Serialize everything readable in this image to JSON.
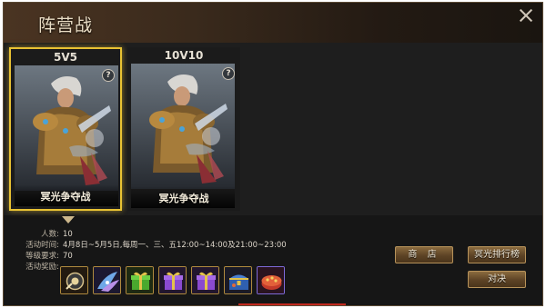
{
  "header": {
    "title": "阵营战"
  },
  "cards": [
    {
      "mode": "5V5",
      "map_name": "冥光争夺战",
      "help": "?",
      "selected": true
    },
    {
      "mode": "10V10",
      "map_name": "冥光争夺战",
      "help": "?",
      "selected": false
    }
  ],
  "info": {
    "players_label": "人数:",
    "players_value": "10",
    "time_label": "活动时间:",
    "time_value": "4月8日~5月5日,每周一、三、五12:00~14:00及21:00~23:00",
    "level_label": "等级要求:",
    "level_value": "70",
    "rewards_label": "活动奖励:"
  },
  "rewards": [
    {
      "icon": "gear-emblem-icon"
    },
    {
      "icon": "blue-wings-icon"
    },
    {
      "icon": "green-gift-box-icon"
    },
    {
      "icon": "purple-gift-box-icon"
    },
    {
      "icon": "purple-gift-box-icon"
    },
    {
      "icon": "treasure-chest-icon"
    },
    {
      "icon": "red-cake-icon"
    }
  ],
  "buttons": {
    "shop": "商 店",
    "rank": "冥光排行榜",
    "duel": "对决"
  },
  "colors": {
    "selected_border": "#e8c233",
    "accent_gold": "#b08a3e",
    "button_base": "#5d4325"
  }
}
